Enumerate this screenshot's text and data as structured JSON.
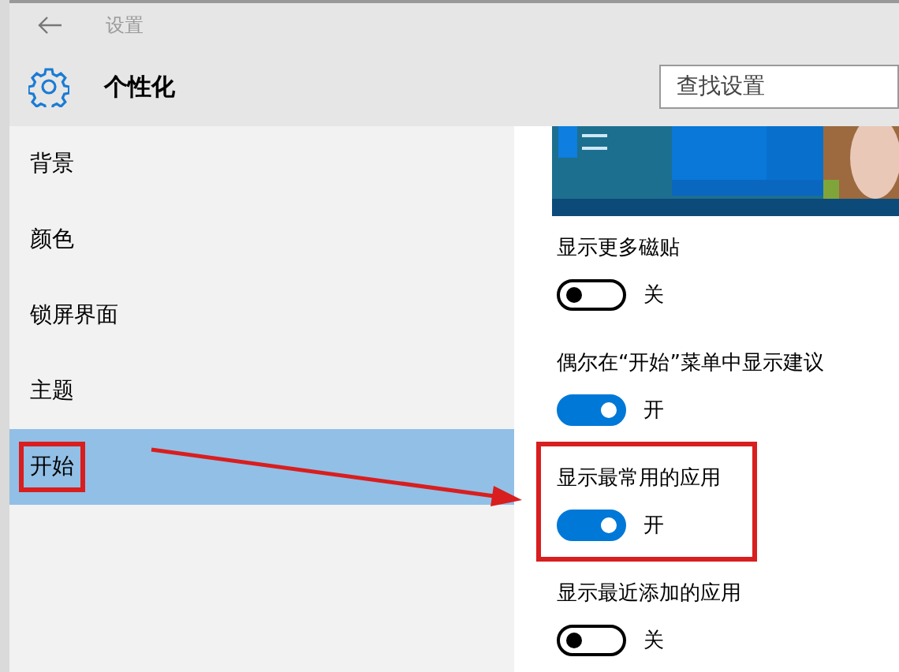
{
  "window": {
    "title": "设置"
  },
  "header": {
    "title": "个性化"
  },
  "search": {
    "placeholder": "查找设置"
  },
  "sidebar": {
    "items": [
      {
        "label": "背景",
        "selected": false,
        "highlighted": false
      },
      {
        "label": "颜色",
        "selected": false,
        "highlighted": false
      },
      {
        "label": "锁屏界面",
        "selected": false,
        "highlighted": false
      },
      {
        "label": "主题",
        "selected": false,
        "highlighted": false
      },
      {
        "label": "开始",
        "selected": true,
        "highlighted": true
      }
    ]
  },
  "settings": [
    {
      "label": "显示更多磁贴",
      "on": false,
      "state_text": "关",
      "highlighted": false
    },
    {
      "label": "偶尔在“开始”菜单中显示建议",
      "on": true,
      "state_text": "开",
      "highlighted": false
    },
    {
      "label": "显示最常用的应用",
      "on": true,
      "state_text": "开",
      "highlighted": true
    },
    {
      "label": "显示最近添加的应用",
      "on": false,
      "state_text": "关",
      "highlighted": false
    }
  ]
}
